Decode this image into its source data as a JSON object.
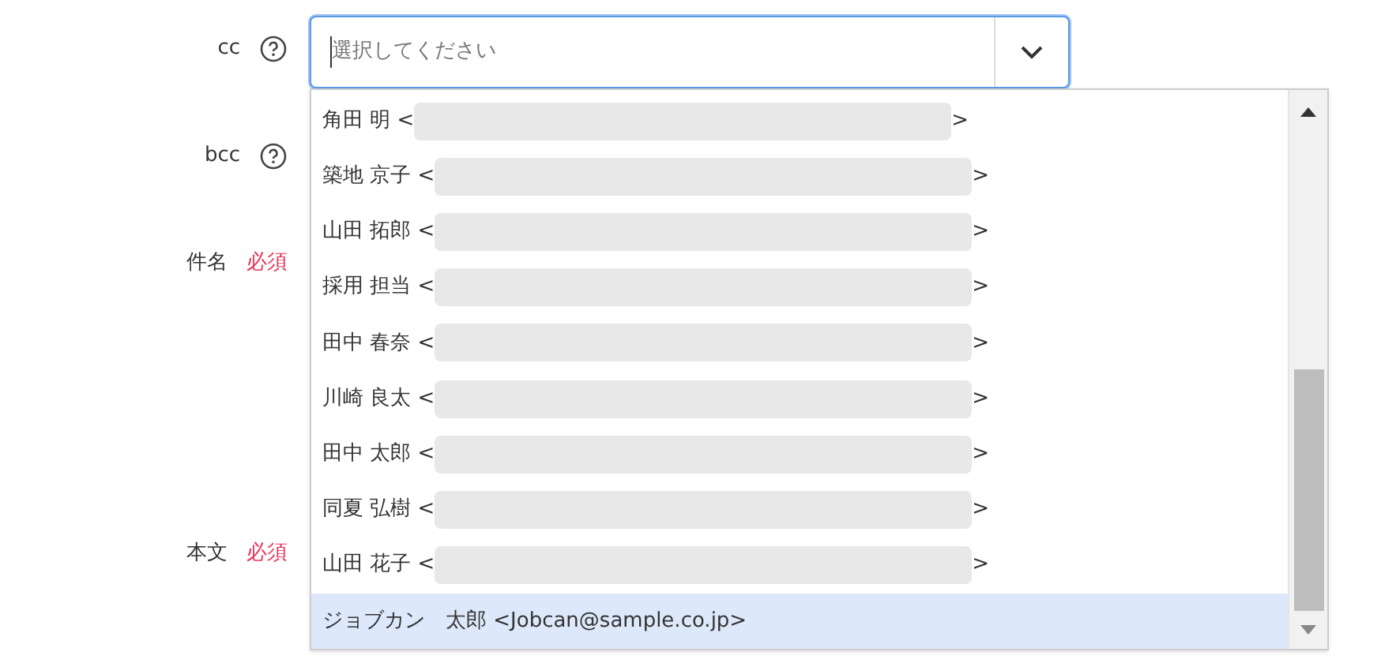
{
  "fields": [
    {
      "label": "cc",
      "help": true
    },
    {
      "label": "bcc",
      "help": true
    },
    {
      "label": "件名",
      "required": "必須"
    },
    {
      "label": "本文",
      "required": "必須"
    }
  ],
  "select": {
    "placeholder": "選択してください",
    "open": true
  },
  "options": [
    {
      "label": "角田 明 <",
      "redacted": true,
      "end": ">",
      "selected": false
    },
    {
      "label": "築地 京子 <",
      "redacted": true,
      "end": ">",
      "selected": false
    },
    {
      "label": "山田 拓郎 <",
      "redacted": true,
      "end": ">",
      "selected": false
    },
    {
      "label": "採用 担当 <",
      "redacted": true,
      "end": ">",
      "selected": false
    },
    {
      "label": "田中 春奈 <",
      "redacted": true,
      "end": ">",
      "selected": false
    },
    {
      "label": "川崎 良太 <",
      "redacted": true,
      "end": ">",
      "selected": false
    },
    {
      "label": "田中 太郎 <",
      "redacted": true,
      "end": ">",
      "selected": false
    },
    {
      "label": "同夏 弘樹 <",
      "redacted": true,
      "end": ">",
      "selected": false
    },
    {
      "label": "山田 花子 <",
      "redacted": true,
      "end": ">",
      "selected": false
    },
    {
      "label": "ジョブカン　太郎 <Jobcan@sample.co.jp>",
      "redacted": false,
      "selected": true
    }
  ]
}
